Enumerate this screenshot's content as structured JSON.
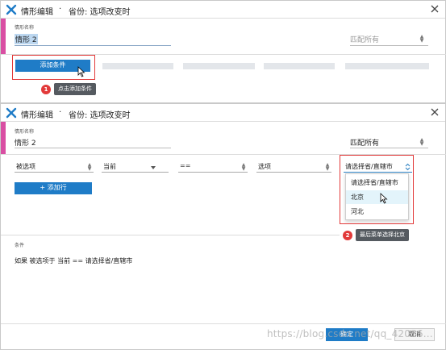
{
  "colors": {
    "accent": "#1f7cc7",
    "pink_bar": "#d94fa3",
    "annotation_red": "#e23a3a",
    "highlight": "#e3f4fb"
  },
  "panel1": {
    "title": "情形编辑",
    "subtitle": "省份: 选项改变时",
    "name_label": "情形名称",
    "name_value": "情形 2",
    "match_placeholder": "匹配所有",
    "add_condition_button": "添加条件",
    "annotation": {
      "number": "1",
      "text": "点击添加条件"
    }
  },
  "panel2": {
    "title": "情形编辑",
    "subtitle": "省份: 选项改变时",
    "name_label": "情形名称",
    "name_value": "情形 2",
    "match_value": "匹配所有",
    "row": {
      "field1": "被选项",
      "field2": "当前",
      "operator": "==",
      "field4": "选项",
      "field5": "请选择省/直辖市"
    },
    "add_row_button": "+ 添加行",
    "dropdown_options": [
      "请选择省/直辖市",
      "北京",
      "河北"
    ],
    "dropdown_highlighted": "北京",
    "annotation": {
      "number": "2",
      "text": "最后菜单选择北京"
    },
    "conditions_label": "条件",
    "conditions_text": "如果  被选项于 当前 == 请选择省/直辖市",
    "ok_button": "确定",
    "cancel_button": "取消",
    "watermark": "https://blog.csdn.net/qq_42036..."
  }
}
